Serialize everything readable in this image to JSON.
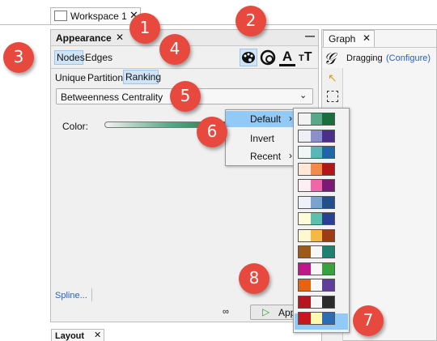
{
  "workspace_tab": {
    "label": "Workspace 1"
  },
  "appearance": {
    "title": "Appearance",
    "element_tabs": [
      "Nodes",
      "Edges"
    ],
    "mode_tabs": [
      "Unique",
      "Partition",
      "Ranking"
    ],
    "ranking_select": "Betweenness Centrality",
    "color_label": "Color:",
    "spline_link": "Spline...",
    "apply_label": "Apply",
    "icons": [
      "palette-icon",
      "size-icon",
      "label-color-icon",
      "label-size-icon"
    ]
  },
  "graph": {
    "tab_label": "Graph",
    "status_label": "Dragging",
    "configure_link": "(Configure)"
  },
  "layout_tab": {
    "label": "Layout"
  },
  "context_menu": {
    "items": [
      "Default",
      "Invert",
      "Recent"
    ]
  },
  "palettes": [
    [
      "#f2f2f2",
      "#5aa889",
      "#1a6e3b"
    ],
    [
      "#eeeef6",
      "#8b8fcc",
      "#4b2f8a"
    ],
    [
      "#eef6f6",
      "#5ab7b7",
      "#1f66a8"
    ],
    [
      "#fde8d8",
      "#f08b4d",
      "#b01818"
    ],
    [
      "#fdeef3",
      "#ee68a8",
      "#7b1a74"
    ],
    [
      "#eef2f8",
      "#7aa3cf",
      "#204f8c"
    ],
    [
      "#fdfbd8",
      "#5fbfae",
      "#27408f"
    ],
    [
      "#fff7d0",
      "#f5b845",
      "#9d3b13"
    ],
    [
      "#9b5a17",
      "#f7f7f7",
      "#1f8071"
    ],
    [
      "#c01788",
      "#f7f7f7",
      "#38a33c"
    ],
    [
      "#e8630f",
      "#f7f7f7",
      "#603d99"
    ],
    [
      "#b5161e",
      "#f7f7f7",
      "#2b2b2b"
    ],
    [
      "#c8161e",
      "#fff9b0",
      "#2e6bb5"
    ]
  ],
  "callouts": [
    "1",
    "2",
    "3",
    "4",
    "5",
    "6",
    "7",
    "8"
  ]
}
